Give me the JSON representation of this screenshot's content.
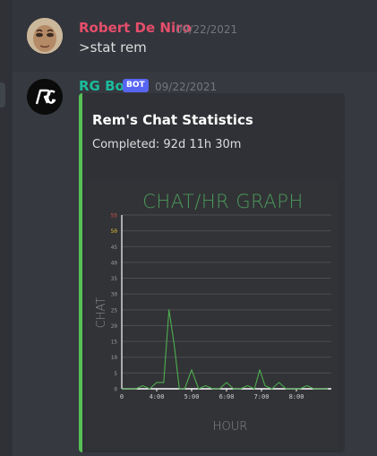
{
  "messages": [
    {
      "username": "Robert De Niro",
      "timestamp": "09/22/2021",
      "content": ">stat rem",
      "name_color": "#e64e6b"
    },
    {
      "username": "RG Bot",
      "bot_tag": "BOT",
      "timestamp": "09/22/2021",
      "name_color": "#1abc9c",
      "embed": {
        "title": "Rem's Chat Statistics",
        "description": "Completed: 92d 11h 30m",
        "accent": "#57c057"
      }
    }
  ],
  "chart_data": {
    "type": "line",
    "title": "CHAT/HR GRAPH",
    "xlabel": "HOUR",
    "ylabel": "CHAT",
    "ylim": [
      0,
      55
    ],
    "yticks": [
      0,
      5,
      10,
      15,
      20,
      25,
      30,
      35,
      40,
      45,
      50,
      55
    ],
    "xtick_labels": [
      "4:00",
      "5:00",
      "6:00",
      "7:00",
      "8:00"
    ],
    "xtick_positions": [
      1,
      2,
      3,
      4,
      5
    ],
    "xlim": [
      0,
      6
    ],
    "line_color": "#4caf50",
    "grid": true,
    "series": [
      {
        "x": [
          0,
          0.2,
          0.4,
          0.6,
          0.8,
          1.0,
          1.2,
          1.35,
          1.5,
          1.65,
          1.8,
          2.0,
          2.2,
          2.4,
          2.6,
          2.8,
          3.0,
          3.2,
          3.4,
          3.6,
          3.8,
          3.95,
          4.1,
          4.3,
          4.5,
          4.7,
          4.9,
          5.1,
          5.3,
          5.5,
          5.7,
          5.9
        ],
        "values": [
          0,
          0,
          0,
          1,
          0,
          2,
          2,
          25,
          14,
          0,
          0,
          6,
          0,
          1,
          0,
          0,
          2,
          0,
          0,
          1,
          0,
          6,
          1,
          0,
          2,
          0,
          0,
          0,
          1,
          0,
          0,
          0
        ]
      }
    ]
  }
}
